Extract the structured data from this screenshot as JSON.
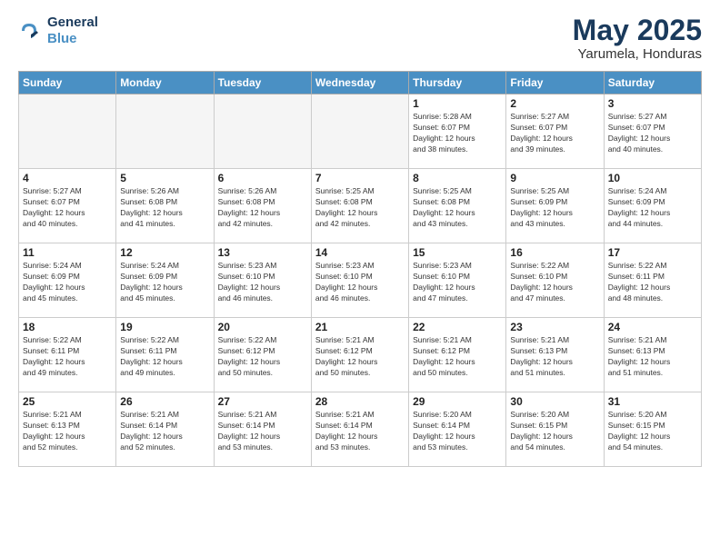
{
  "header": {
    "logo_line1": "General",
    "logo_line2": "Blue",
    "title": "May 2025",
    "subtitle": "Yarumela, Honduras"
  },
  "weekdays": [
    "Sunday",
    "Monday",
    "Tuesday",
    "Wednesday",
    "Thursday",
    "Friday",
    "Saturday"
  ],
  "weeks": [
    [
      {
        "day": "",
        "info": ""
      },
      {
        "day": "",
        "info": ""
      },
      {
        "day": "",
        "info": ""
      },
      {
        "day": "",
        "info": ""
      },
      {
        "day": "1",
        "info": "Sunrise: 5:28 AM\nSunset: 6:07 PM\nDaylight: 12 hours\nand 38 minutes."
      },
      {
        "day": "2",
        "info": "Sunrise: 5:27 AM\nSunset: 6:07 PM\nDaylight: 12 hours\nand 39 minutes."
      },
      {
        "day": "3",
        "info": "Sunrise: 5:27 AM\nSunset: 6:07 PM\nDaylight: 12 hours\nand 40 minutes."
      }
    ],
    [
      {
        "day": "4",
        "info": "Sunrise: 5:27 AM\nSunset: 6:07 PM\nDaylight: 12 hours\nand 40 minutes."
      },
      {
        "day": "5",
        "info": "Sunrise: 5:26 AM\nSunset: 6:08 PM\nDaylight: 12 hours\nand 41 minutes."
      },
      {
        "day": "6",
        "info": "Sunrise: 5:26 AM\nSunset: 6:08 PM\nDaylight: 12 hours\nand 42 minutes."
      },
      {
        "day": "7",
        "info": "Sunrise: 5:25 AM\nSunset: 6:08 PM\nDaylight: 12 hours\nand 42 minutes."
      },
      {
        "day": "8",
        "info": "Sunrise: 5:25 AM\nSunset: 6:08 PM\nDaylight: 12 hours\nand 43 minutes."
      },
      {
        "day": "9",
        "info": "Sunrise: 5:25 AM\nSunset: 6:09 PM\nDaylight: 12 hours\nand 43 minutes."
      },
      {
        "day": "10",
        "info": "Sunrise: 5:24 AM\nSunset: 6:09 PM\nDaylight: 12 hours\nand 44 minutes."
      }
    ],
    [
      {
        "day": "11",
        "info": "Sunrise: 5:24 AM\nSunset: 6:09 PM\nDaylight: 12 hours\nand 45 minutes."
      },
      {
        "day": "12",
        "info": "Sunrise: 5:24 AM\nSunset: 6:09 PM\nDaylight: 12 hours\nand 45 minutes."
      },
      {
        "day": "13",
        "info": "Sunrise: 5:23 AM\nSunset: 6:10 PM\nDaylight: 12 hours\nand 46 minutes."
      },
      {
        "day": "14",
        "info": "Sunrise: 5:23 AM\nSunset: 6:10 PM\nDaylight: 12 hours\nand 46 minutes."
      },
      {
        "day": "15",
        "info": "Sunrise: 5:23 AM\nSunset: 6:10 PM\nDaylight: 12 hours\nand 47 minutes."
      },
      {
        "day": "16",
        "info": "Sunrise: 5:22 AM\nSunset: 6:10 PM\nDaylight: 12 hours\nand 47 minutes."
      },
      {
        "day": "17",
        "info": "Sunrise: 5:22 AM\nSunset: 6:11 PM\nDaylight: 12 hours\nand 48 minutes."
      }
    ],
    [
      {
        "day": "18",
        "info": "Sunrise: 5:22 AM\nSunset: 6:11 PM\nDaylight: 12 hours\nand 49 minutes."
      },
      {
        "day": "19",
        "info": "Sunrise: 5:22 AM\nSunset: 6:11 PM\nDaylight: 12 hours\nand 49 minutes."
      },
      {
        "day": "20",
        "info": "Sunrise: 5:22 AM\nSunset: 6:12 PM\nDaylight: 12 hours\nand 50 minutes."
      },
      {
        "day": "21",
        "info": "Sunrise: 5:21 AM\nSunset: 6:12 PM\nDaylight: 12 hours\nand 50 minutes."
      },
      {
        "day": "22",
        "info": "Sunrise: 5:21 AM\nSunset: 6:12 PM\nDaylight: 12 hours\nand 50 minutes."
      },
      {
        "day": "23",
        "info": "Sunrise: 5:21 AM\nSunset: 6:13 PM\nDaylight: 12 hours\nand 51 minutes."
      },
      {
        "day": "24",
        "info": "Sunrise: 5:21 AM\nSunset: 6:13 PM\nDaylight: 12 hours\nand 51 minutes."
      }
    ],
    [
      {
        "day": "25",
        "info": "Sunrise: 5:21 AM\nSunset: 6:13 PM\nDaylight: 12 hours\nand 52 minutes."
      },
      {
        "day": "26",
        "info": "Sunrise: 5:21 AM\nSunset: 6:14 PM\nDaylight: 12 hours\nand 52 minutes."
      },
      {
        "day": "27",
        "info": "Sunrise: 5:21 AM\nSunset: 6:14 PM\nDaylight: 12 hours\nand 53 minutes."
      },
      {
        "day": "28",
        "info": "Sunrise: 5:21 AM\nSunset: 6:14 PM\nDaylight: 12 hours\nand 53 minutes."
      },
      {
        "day": "29",
        "info": "Sunrise: 5:20 AM\nSunset: 6:14 PM\nDaylight: 12 hours\nand 53 minutes."
      },
      {
        "day": "30",
        "info": "Sunrise: 5:20 AM\nSunset: 6:15 PM\nDaylight: 12 hours\nand 54 minutes."
      },
      {
        "day": "31",
        "info": "Sunrise: 5:20 AM\nSunset: 6:15 PM\nDaylight: 12 hours\nand 54 minutes."
      }
    ]
  ]
}
